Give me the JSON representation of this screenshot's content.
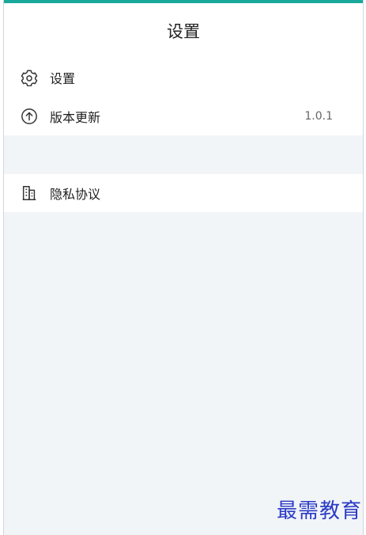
{
  "header": {
    "title": "设置"
  },
  "menu": {
    "settings": {
      "label": "设置",
      "icon": "gear-icon"
    },
    "version_update": {
      "label": "版本更新",
      "value": "1.0.1",
      "icon": "arrow-up-circle-icon"
    },
    "privacy": {
      "label": "隐私协议",
      "icon": "building-icon"
    }
  },
  "colors": {
    "accent": "#1aa89a",
    "background": "#f2f5f8",
    "watermark": "#2a3bc4"
  },
  "watermark": {
    "text": "最需教育"
  }
}
